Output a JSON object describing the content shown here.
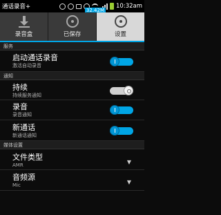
{
  "statusbar": {
    "title": "通话录音+",
    "memory": "32.42M",
    "time": "10:32am"
  },
  "tabs": [
    {
      "label": "录音盒",
      "icon": "download-icon",
      "active": false
    },
    {
      "label": "已保存",
      "icon": "disc-icon",
      "active": false
    },
    {
      "label": "设置",
      "icon": "disc-icon",
      "active": true
    }
  ],
  "sections": {
    "service": "服务",
    "notify": "通知",
    "media": "媒体设置"
  },
  "settings": {
    "auto_record": {
      "title": "启动通话录音",
      "subtitle": "激活自动录音",
      "enabled": true
    },
    "persistent": {
      "title": "持续",
      "subtitle": "持续服务通知",
      "enabled": false
    },
    "recording": {
      "title": "录音",
      "subtitle": "录音通知",
      "enabled": true
    },
    "new_call": {
      "title": "新通话",
      "subtitle": "新通话通知",
      "enabled": true
    },
    "file_type": {
      "title": "文件类型",
      "value": "AMR"
    },
    "audio_source": {
      "title": "音频源",
      "value": "Mic"
    }
  },
  "colors": {
    "accent": "#00a6e6",
    "toggle_off": "#d0d0d0"
  }
}
